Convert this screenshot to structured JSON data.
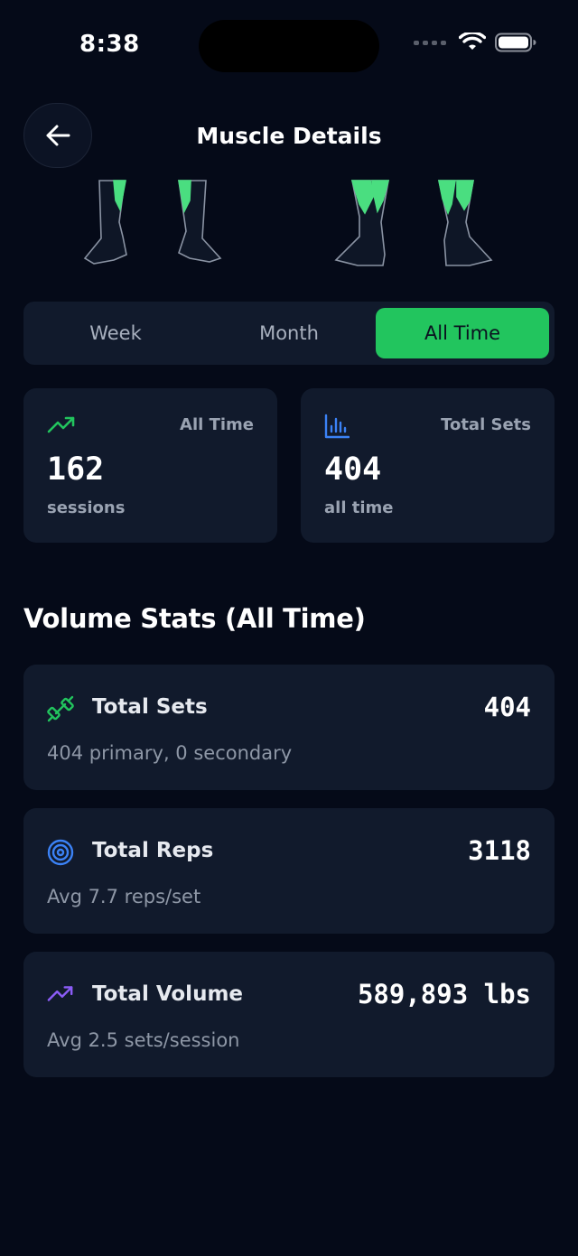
{
  "status_bar": {
    "time": "8:38"
  },
  "header": {
    "title": "Muscle Details"
  },
  "colors": {
    "accent": "#22C55E",
    "card": "#111A2C",
    "background": "#050A18",
    "blue": "#3B82F6",
    "purple": "#8B5CF6"
  },
  "period_tabs": [
    {
      "label": "Week",
      "active": false
    },
    {
      "label": "Month",
      "active": false
    },
    {
      "label": "All Time",
      "active": true
    }
  ],
  "summary_cards": [
    {
      "icon": "trending-up-icon",
      "label": "All Time",
      "value": "162",
      "sub": "sessions"
    },
    {
      "icon": "bar-chart-icon",
      "label": "Total Sets",
      "value": "404",
      "sub": "all time"
    }
  ],
  "volume_section": {
    "title": "Volume Stats (All Time)",
    "cards": [
      {
        "icon": "dumbbell-icon",
        "title": "Total Sets",
        "value": "404",
        "desc": "404 primary, 0 secondary"
      },
      {
        "icon": "target-icon",
        "title": "Total Reps",
        "value": "3118",
        "desc": "Avg 7.7 reps/set"
      },
      {
        "icon": "trending-up-icon",
        "title": "Total Volume",
        "value": "589,893 lbs",
        "desc": "Avg 2.5 sets/session"
      }
    ]
  }
}
